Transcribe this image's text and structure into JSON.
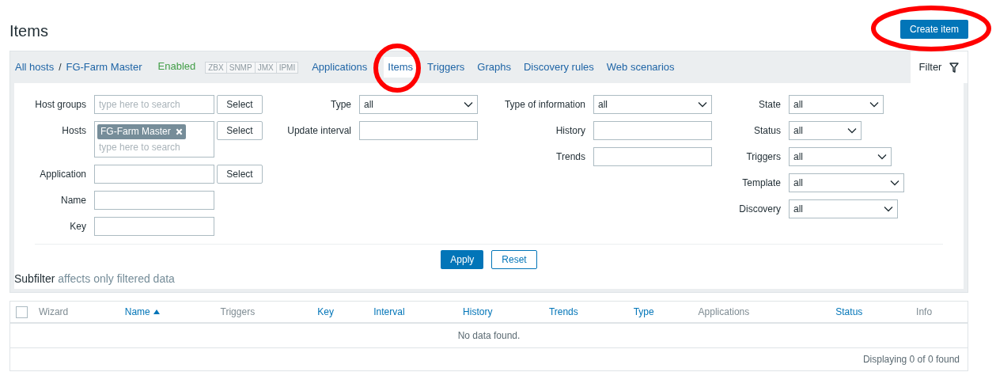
{
  "page_title": "Items",
  "create_button": "Create item",
  "breadcrumbs": [
    {
      "label": "All hosts"
    },
    {
      "label": "FG-Farm Master"
    }
  ],
  "breadcrumb_separator": "/",
  "host_status": "Enabled",
  "availability": [
    {
      "label": "ZBX"
    },
    {
      "label": "SNMP"
    },
    {
      "label": "JMX"
    },
    {
      "label": "IPMI"
    }
  ],
  "tabs": [
    {
      "label": "Applications",
      "selected": false
    },
    {
      "label": "Items",
      "selected": true
    },
    {
      "label": "Triggers",
      "selected": false
    },
    {
      "label": "Graphs",
      "selected": false
    },
    {
      "label": "Discovery rules",
      "selected": false
    },
    {
      "label": "Web scenarios",
      "selected": false
    }
  ],
  "filter_tab": {
    "label": "Filter",
    "expanded": true
  },
  "filter": {
    "columns": [
      [
        {
          "kind": "multiselect",
          "label": "Host groups",
          "placeholder": "type here to search",
          "button": "Select"
        },
        {
          "kind": "multiselect",
          "label": "Hosts",
          "chips": [
            "FG-Farm Master"
          ],
          "placeholder": "type here to search",
          "button": "Select"
        },
        {
          "kind": "text",
          "label": "Application",
          "button": "Select"
        },
        {
          "kind": "text",
          "label": "Name"
        },
        {
          "kind": "text",
          "label": "Key"
        }
      ],
      [
        {
          "kind": "select",
          "label": "Type",
          "value": "all"
        },
        {
          "kind": "text",
          "label": "Update interval"
        }
      ],
      [
        {
          "kind": "select",
          "label": "Type of information",
          "value": "all"
        },
        {
          "kind": "text",
          "label": "History"
        },
        {
          "kind": "text",
          "label": "Trends"
        }
      ],
      [
        {
          "kind": "select",
          "label": "State",
          "value": "all"
        },
        {
          "kind": "select",
          "label": "Status",
          "value": "all"
        },
        {
          "kind": "select",
          "label": "Triggers",
          "value": "all"
        },
        {
          "kind": "select",
          "label": "Template",
          "value": "all"
        },
        {
          "kind": "select",
          "label": "Discovery",
          "value": "all"
        }
      ]
    ],
    "apply_button": "Apply",
    "reset_button": "Reset"
  },
  "subfilter": {
    "title": "Subfilter",
    "note": "affects only filtered data"
  },
  "table": {
    "select_all_checked": false,
    "columns": [
      {
        "label": "Wizard",
        "sortable": false
      },
      {
        "label": "Name",
        "sortable": true,
        "sorted_ascending": true
      },
      {
        "label": "Triggers",
        "sortable": false
      },
      {
        "label": "Key",
        "sortable": true
      },
      {
        "label": "Interval",
        "sortable": true
      },
      {
        "label": "History",
        "sortable": true
      },
      {
        "label": "Trends",
        "sortable": true
      },
      {
        "label": "Type",
        "sortable": true
      },
      {
        "label": "Applications",
        "sortable": false
      },
      {
        "label": "Status",
        "sortable": true
      },
      {
        "label": "Info",
        "sortable": false
      }
    ],
    "empty_message": "No data found.",
    "footer": "Displaying 0 of 0 found"
  },
  "annotations": [
    {
      "kind": "circle"
    },
    {
      "kind": "circle"
    }
  ]
}
